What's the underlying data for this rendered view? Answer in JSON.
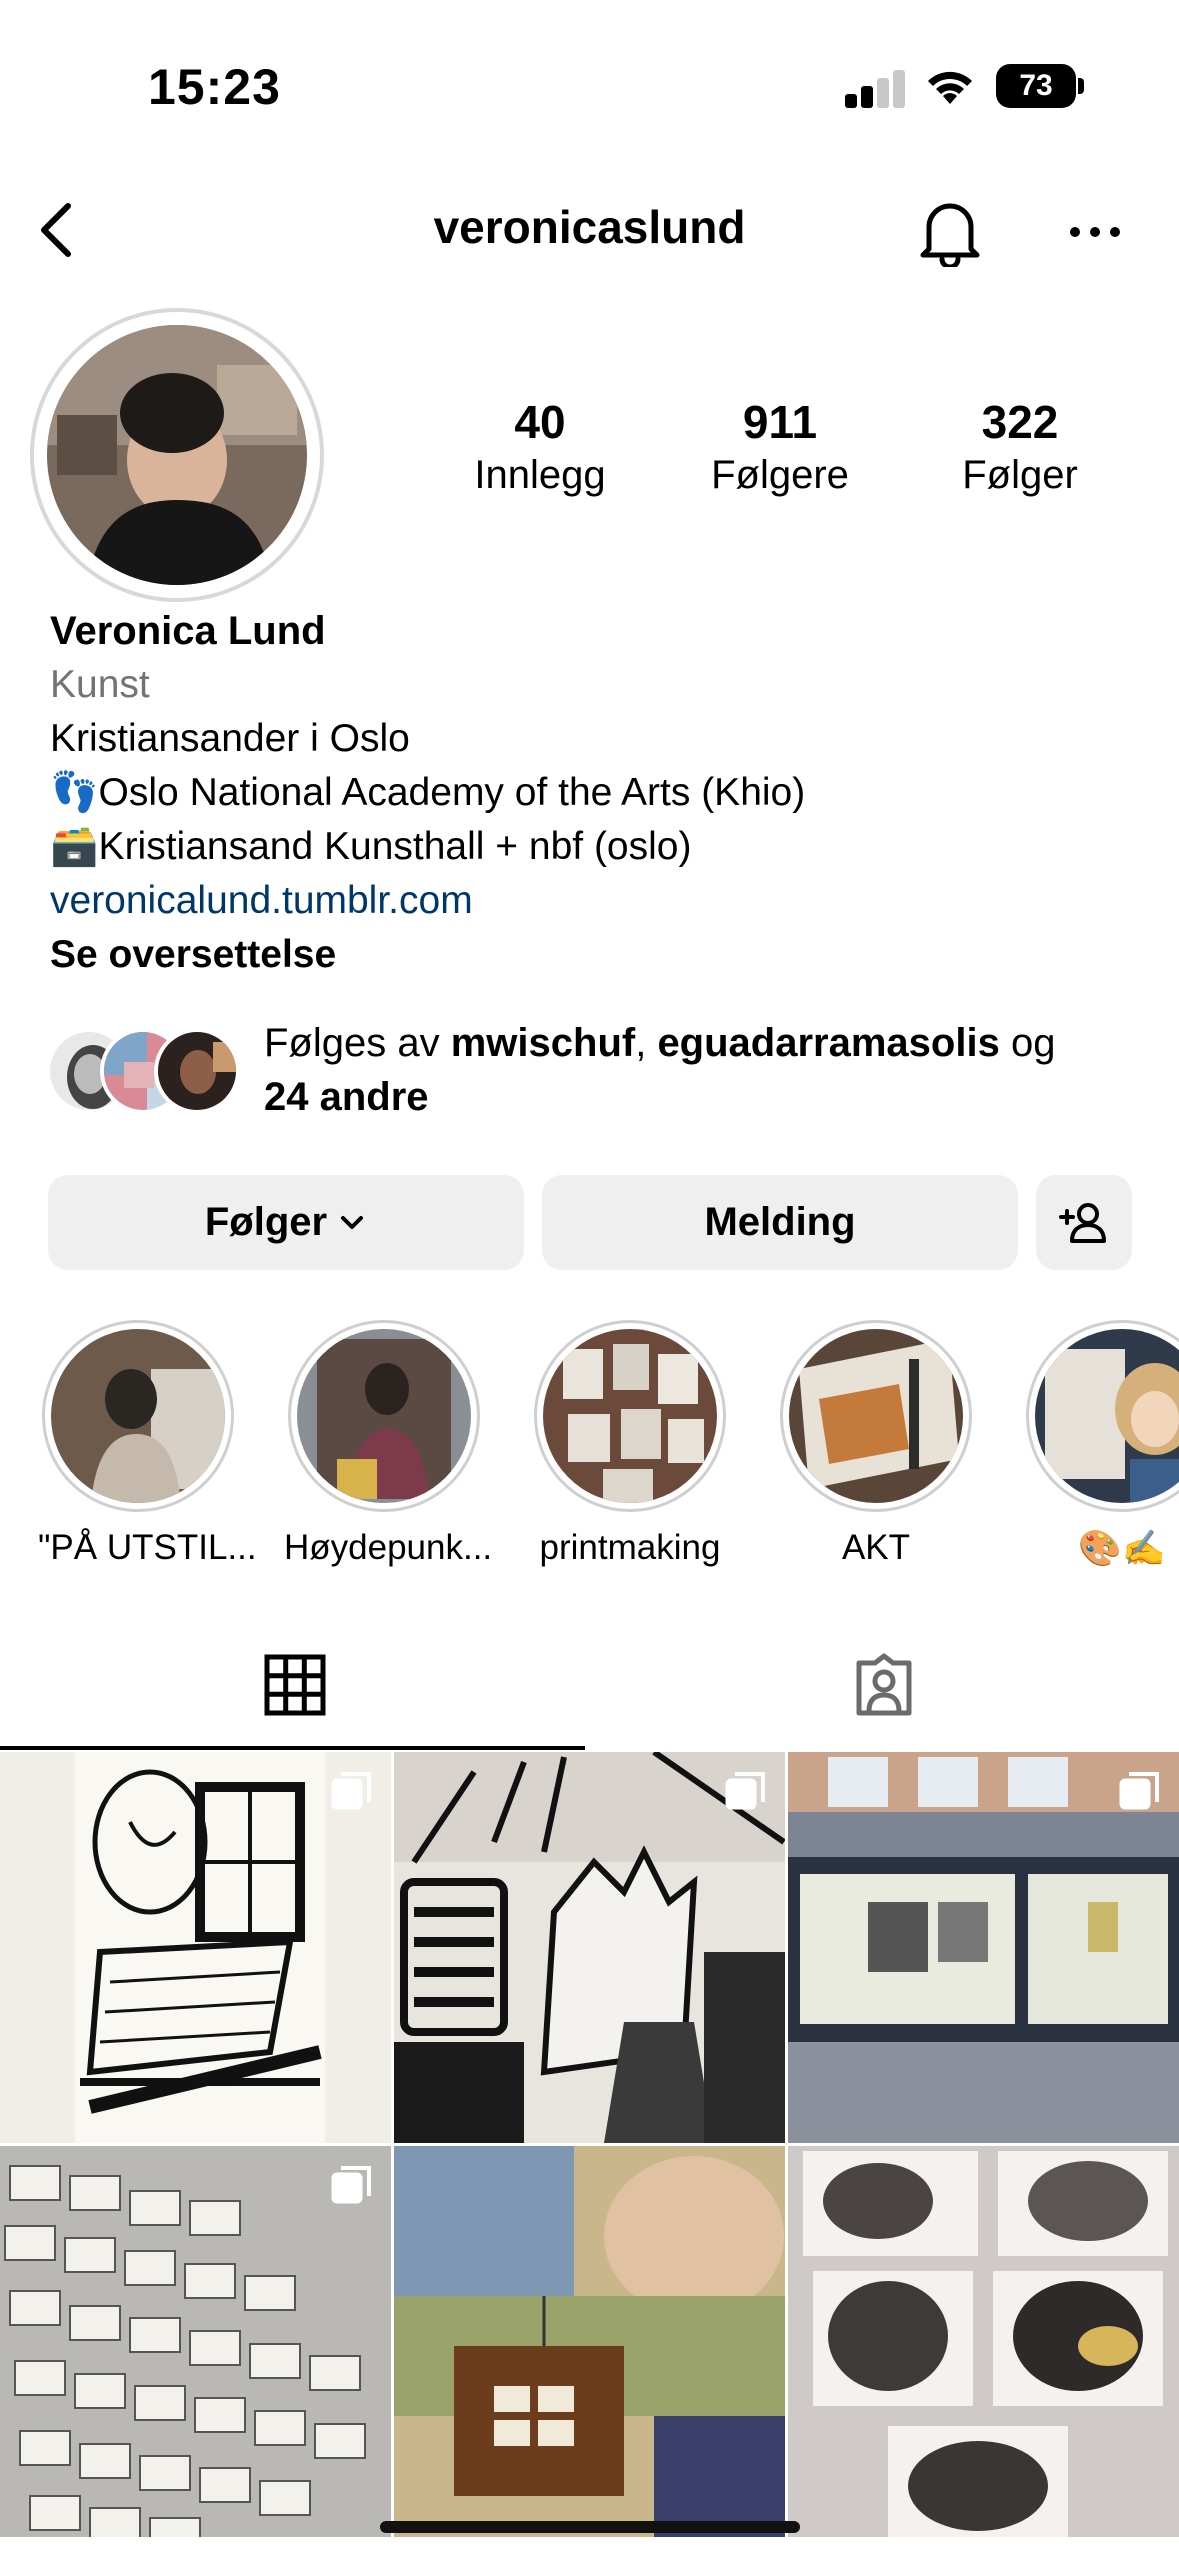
{
  "status_bar": {
    "time": "15:23",
    "battery": "73"
  },
  "header": {
    "username": "veronicaslund"
  },
  "stats": [
    {
      "value": "40",
      "label": "Innlegg"
    },
    {
      "value": "911",
      "label": "Følgere"
    },
    {
      "value": "322",
      "label": "Følger"
    }
  ],
  "bio": {
    "name": "Veronica Lund",
    "category": "Kunst",
    "line1": "Kristiansander i Oslo",
    "line2": "👣Oslo National Academy of the Arts (Khio)",
    "line3": "🗃️Kristiansand Kunsthall + nbf (oslo)",
    "link": "veronicalund.tumblr.com",
    "translate": "Se oversettelse"
  },
  "followed_by": {
    "prefix": "Følges av ",
    "user1": "mwischuf",
    "sep": ", ",
    "user2": "eguadarramasolis",
    "mid": " og",
    "others": "24 andre"
  },
  "actions": {
    "following": "Følger",
    "message": "Melding"
  },
  "highlights": [
    {
      "label": "\"PÅ UTSTIL..."
    },
    {
      "label": "Høydepunk..."
    },
    {
      "label": "printmaking"
    },
    {
      "label": "AKT"
    },
    {
      "label": "🎨✍️"
    }
  ],
  "icons": {
    "back": "chevron-left-icon",
    "bell": "bell-icon",
    "more": "ellipsis-icon",
    "add_person": "add-person-icon",
    "grid": "grid-icon",
    "tagged": "tagged-icon",
    "multi": "multiple-posts-icon"
  },
  "colors": {
    "link": "#00376b",
    "button_bg": "#efefef",
    "muted": "#737373"
  }
}
